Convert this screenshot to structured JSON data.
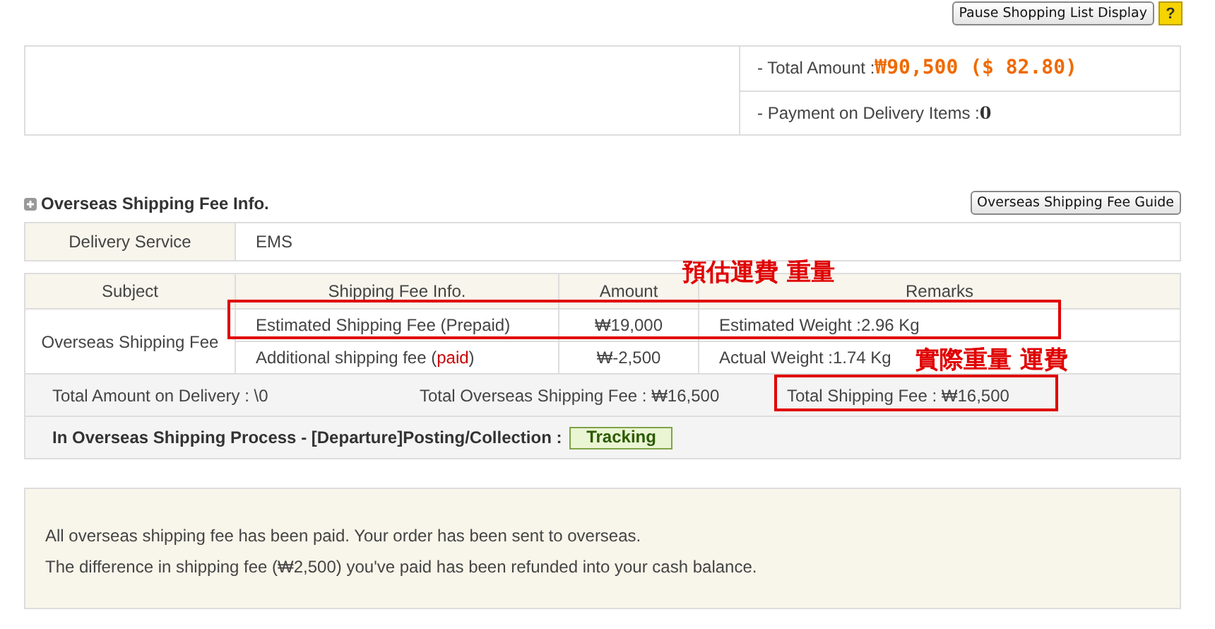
{
  "top_buttons": {
    "pause": "Pause Shopping List Display",
    "help": "?"
  },
  "summary": {
    "total_label": "- Total Amount : ",
    "total_value": "₩90,500 ($ 82.80)",
    "cod_label": "- Payment on Delivery Items : ",
    "cod_value": "0"
  },
  "section": {
    "title": "Overseas Shipping Fee Info.",
    "guide_button": "Overseas Shipping Fee Guide"
  },
  "delivery": {
    "label": "Delivery Service",
    "value": "EMS"
  },
  "table": {
    "columns": [
      "Subject",
      "Shipping Fee Info.",
      "Amount",
      "Remarks"
    ],
    "subject": "Overseas Shipping Fee",
    "rows": [
      {
        "info_parts": [
          {
            "text": "Estimated Shipping Fee (Prepaid)",
            "highlight": false
          }
        ],
        "amount": "₩19,000",
        "remarks": "Estimated Weight :2.96 Kg"
      },
      {
        "info_parts": [
          {
            "text": "Additional shipping fee (",
            "highlight": false
          },
          {
            "text": "paid",
            "highlight": true
          },
          {
            "text": ")",
            "highlight": false
          }
        ],
        "amount": "₩-2,500",
        "remarks": "Actual Weight :1.74 Kg"
      }
    ],
    "totals": [
      "Total Amount on Delivery : \\0",
      "Total Overseas Shipping Fee : ₩16,500",
      "Total Shipping Fee : ₩16,500"
    ],
    "process_label": "In Overseas Shipping Process - [Departure]Posting/Collection : ",
    "tracking_button": "Tracking"
  },
  "message": [
    "All overseas shipping fee has been paid. Your order has been sent to overseas.",
    "The difference in shipping fee (₩2,500) you've paid has been refunded into your cash balance."
  ],
  "annotations": [
    {
      "text": "預估運費 重量",
      "kind": "estimate"
    },
    {
      "text": "實際重量 運費",
      "kind": "actual"
    }
  ]
}
